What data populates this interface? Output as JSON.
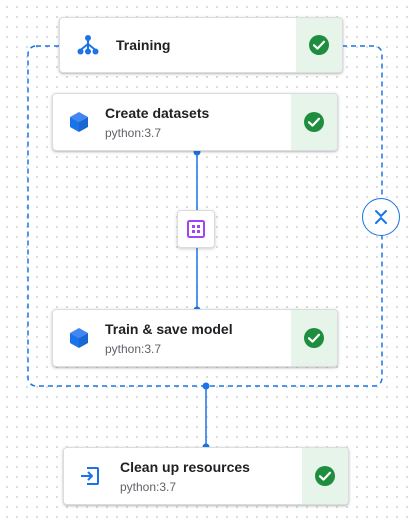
{
  "group": {
    "title": "Training",
    "status": "succeeded",
    "icon": "pipeline-fork-icon"
  },
  "nodes": [
    {
      "title": "Create datasets",
      "subtitle": "python:3.7",
      "status": "succeeded",
      "icon": "cube-icon"
    },
    {
      "title": "Train & save model",
      "subtitle": "python:3.7",
      "status": "succeeded",
      "icon": "cube-icon"
    },
    {
      "title": "Clean up resources",
      "subtitle": "python:3.7",
      "status": "succeeded",
      "icon": "exit-icon"
    }
  ],
  "artifact": {
    "icon": "artifact-grid-icon"
  },
  "collapse_control": {
    "icon": "collapse-chevrons-icon"
  },
  "colors": {
    "accent": "#1a73e8",
    "success": "#1e8e3e",
    "success_bg": "#e6f4ea",
    "artifact": "#a142f4"
  }
}
